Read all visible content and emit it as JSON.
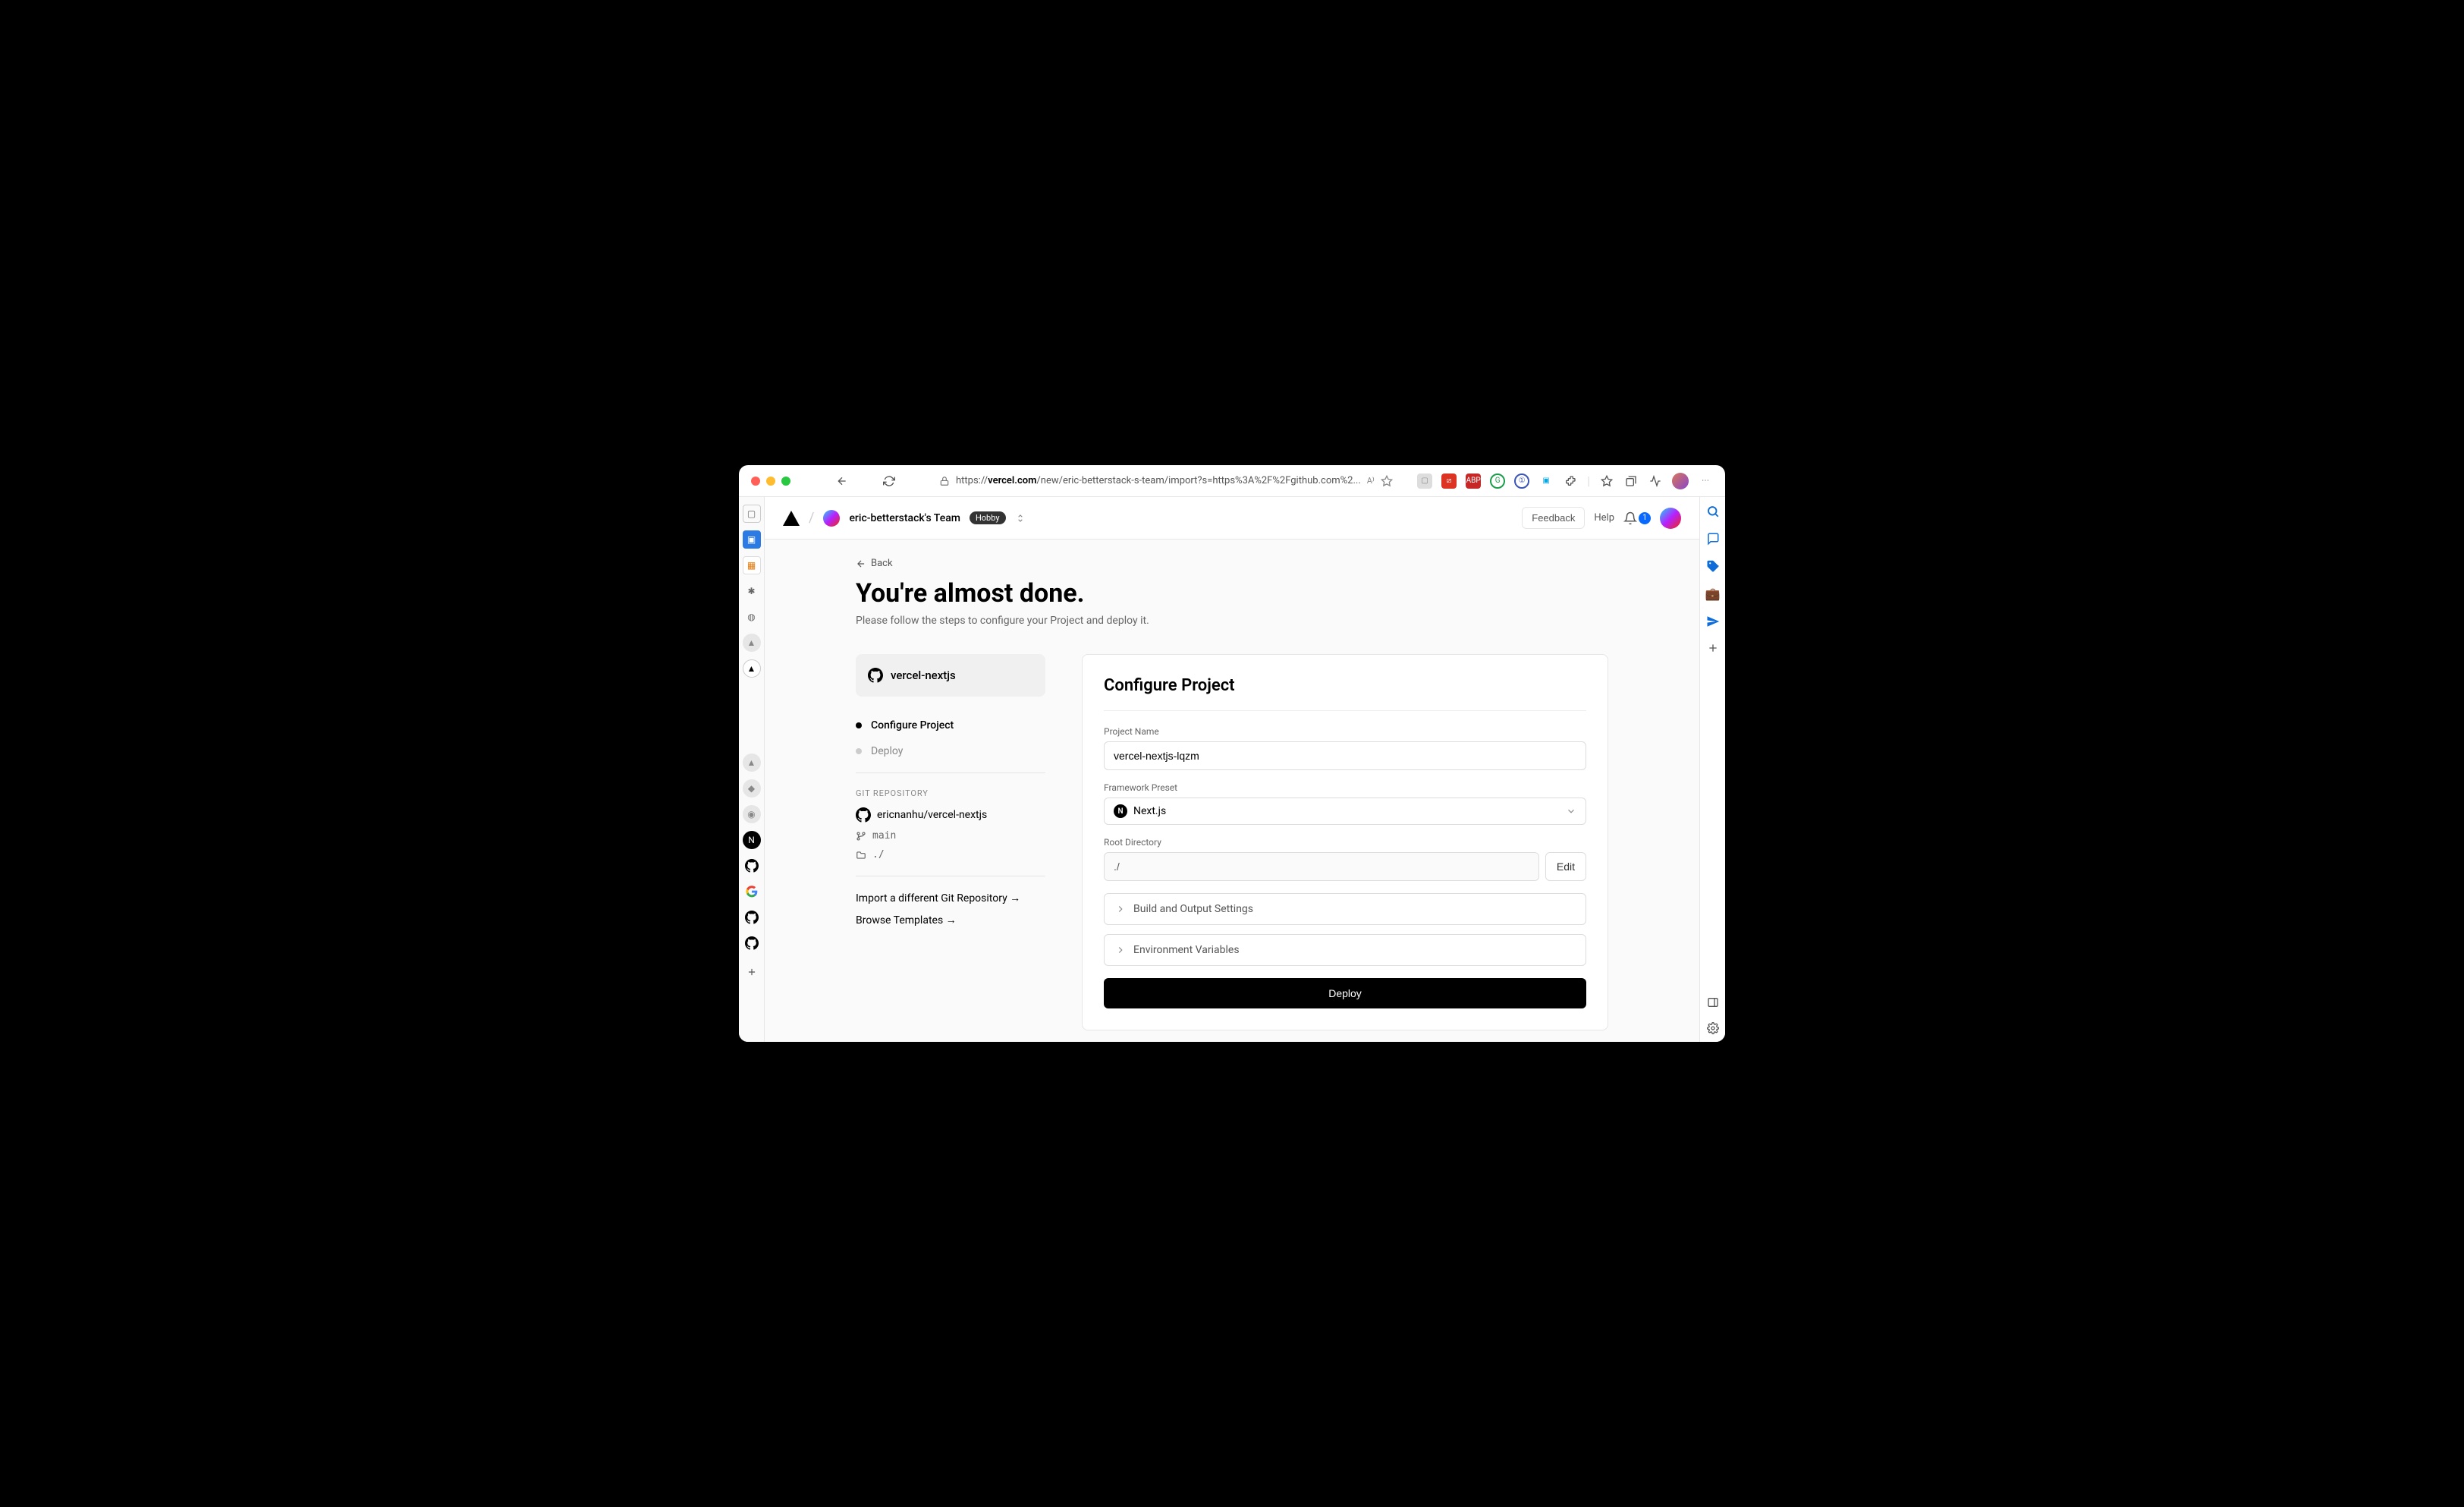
{
  "browser": {
    "url_prefix": "https://",
    "url_host": "vercel.com",
    "url_path": "/new/eric-betterstack-s-team/import?s=https%3A%2F%2Fgithub.com%2...",
    "ext_abp": "ABP"
  },
  "header": {
    "team_name": "eric-betterstack's Team",
    "plan_badge": "Hobby",
    "feedback": "Feedback",
    "help": "Help",
    "notification_count": "1"
  },
  "page": {
    "back": "Back",
    "title": "You're almost done.",
    "subtitle": "Please follow the steps to configure your Project and deploy it."
  },
  "sidebar": {
    "repo_name": "vercel-nextjs",
    "steps": [
      {
        "label": "Configure Project",
        "active": true
      },
      {
        "label": "Deploy",
        "active": false
      }
    ],
    "git_heading": "GIT REPOSITORY",
    "repo_path": "ericnanhu/vercel-nextjs",
    "branch": "main",
    "directory": "./",
    "import_link": "Import a different Git Repository →",
    "browse_link": "Browse Templates →"
  },
  "form": {
    "title": "Configure Project",
    "project_name_label": "Project Name",
    "project_name_value": "vercel-nextjs-lqzm",
    "framework_label": "Framework Preset",
    "framework_value": "Next.js",
    "root_label": "Root Directory",
    "root_value": "./",
    "edit": "Edit",
    "build_settings": "Build and Output Settings",
    "env_vars": "Environment Variables",
    "deploy": "Deploy"
  }
}
